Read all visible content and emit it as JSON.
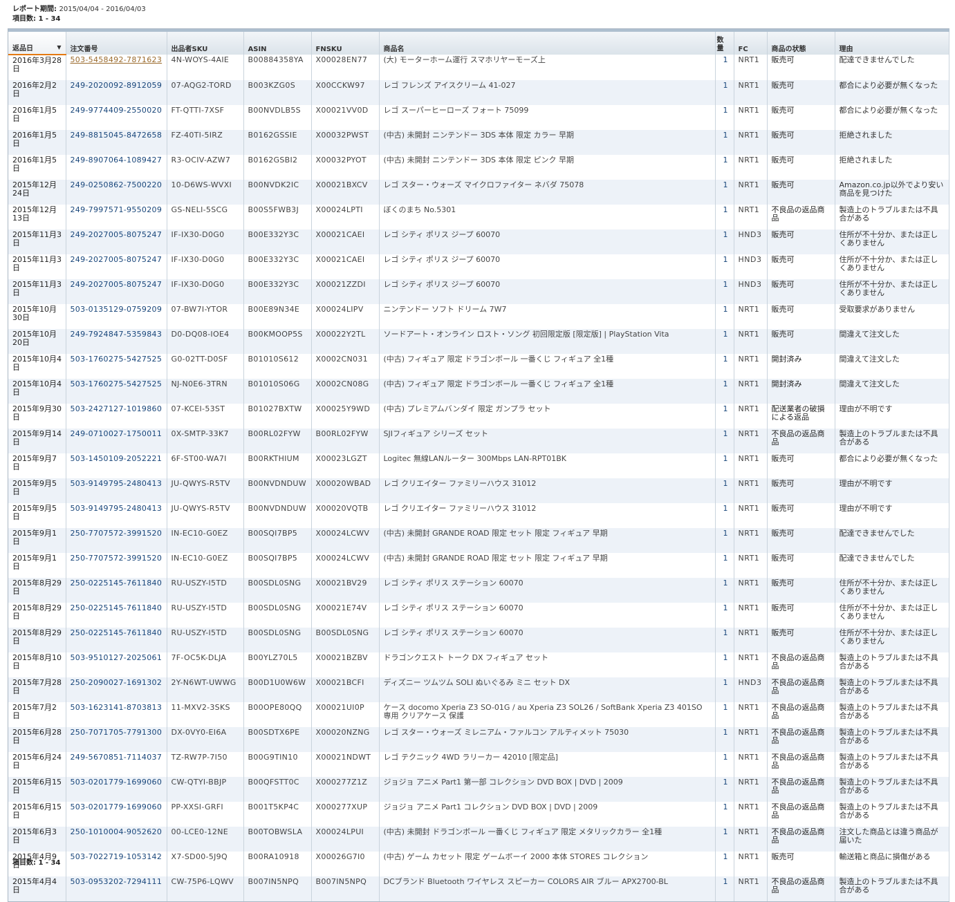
{
  "report": {
    "period_label": "レポート期間: ",
    "period_value": "2015/04/04 - 2016/04/03",
    "count_label": "項目数: ",
    "count_value": "1 - 34"
  },
  "columns": {
    "return_date": "返品日",
    "order_id": "注文番号",
    "seller_sku": "出品者SKU",
    "asin": "ASIN",
    "fnsku": "FNSKU",
    "product_name": "商品名",
    "quantity": "数量",
    "fc": "FC",
    "condition": "商品の状態",
    "reason": "理由"
  },
  "rows": [
    {
      "date": "2016年3月28日",
      "order": "503-5458492-7871623",
      "sku": "4N-WOYS-4AIE",
      "asin": "B00884358YA",
      "fnsku": "X00028EN77",
      "product": "(大) モーターホーム運行 スマホリヤーモーズ上",
      "qty": "1",
      "fc": "NRT1",
      "condition": "販売可",
      "reason": "配達できませんでした"
    },
    {
      "date": "2016年2月2日",
      "order": "249-2020092-8912059",
      "sku": "07-AQG2-TORD",
      "asin": "B003KZG0S",
      "fnsku": "X00CCKW97",
      "product": "レゴ フレンズ アイスクリーム 41-027",
      "qty": "1",
      "fc": "NRT1",
      "condition": "販売可",
      "reason": "都合により必要が無くなった"
    },
    {
      "date": "2016年1月5日",
      "order": "249-9774409-2550020",
      "sku": "FT-QTTI-7XSF",
      "asin": "B00NVDLB5S",
      "fnsku": "X00021VV0D",
      "product": "レゴ スーパーヒーローズ フォート 75099",
      "qty": "1",
      "fc": "NRT1",
      "condition": "販売可",
      "reason": "都合により必要が無くなった"
    },
    {
      "date": "2016年1月5日",
      "order": "249-8815045-8472658",
      "sku": "FZ-40TI-5IRZ",
      "asin": "B0162GSSIE",
      "fnsku": "X00032PWST",
      "product": "(中古) 未開封 ニンテンドー 3DS 本体 限定 カラー 早期",
      "qty": "1",
      "fc": "NRT1",
      "condition": "販売可",
      "reason": "拒絶されました"
    },
    {
      "date": "2016年1月5日",
      "order": "249-8907064-1089427",
      "sku": "R3-OCIV-AZW7",
      "asin": "B0162GSBI2",
      "fnsku": "X00032PYOT",
      "product": "(中古) 未開封 ニンテンドー 3DS 本体 限定 ピンク 早期",
      "qty": "1",
      "fc": "NRT1",
      "condition": "販売可",
      "reason": "拒絶されました"
    },
    {
      "date": "2015年12月24日",
      "order": "249-0250862-7500220",
      "sku": "10-D6WS-WVXI",
      "asin": "B00NVDK2IC",
      "fnsku": "X00021BXCV",
      "product": "レゴ スター・ウォーズ マイクロファイター ネバダ 75078",
      "qty": "1",
      "fc": "NRT1",
      "condition": "販売可",
      "reason": "Amazon.co.jp以外でより安い商品を見つけた"
    },
    {
      "date": "2015年12月13日",
      "order": "249-7997571-9550209",
      "sku": "GS-NELI-5SCG",
      "asin": "B00S5FWB3J",
      "fnsku": "X00024LPTI",
      "product": "ぼくのまち No.5301",
      "qty": "1",
      "fc": "NRT1",
      "condition": "不良品の返品商品",
      "reason": "製造上のトラブルまたは不具合がある"
    },
    {
      "date": "2015年11月3日",
      "order": "249-2027005-8075247",
      "sku": "IF-IX30-D0G0",
      "asin": "B00E332Y3C",
      "fnsku": "X00021CAEI",
      "product": "レゴ シティ ポリス ジープ 60070",
      "qty": "1",
      "fc": "HND3",
      "condition": "販売可",
      "reason": "住所が不十分か、または正しくありません"
    },
    {
      "date": "2015年11月3日",
      "order": "249-2027005-8075247",
      "sku": "IF-IX30-D0G0",
      "asin": "B00E332Y3C",
      "fnsku": "X00021CAEI",
      "product": "レゴ シティ ポリス ジープ 60070",
      "qty": "1",
      "fc": "HND3",
      "condition": "販売可",
      "reason": "住所が不十分か、または正しくありません"
    },
    {
      "date": "2015年11月3日",
      "order": "249-2027005-8075247",
      "sku": "IF-IX30-D0G0",
      "asin": "B00E332Y3C",
      "fnsku": "X00021ZZDI",
      "product": "レゴ シティ ポリス ジープ 60070",
      "qty": "1",
      "fc": "HND3",
      "condition": "販売可",
      "reason": "住所が不十分か、または正しくありません"
    },
    {
      "date": "2015年10月30日",
      "order": "503-0135129-0759209",
      "sku": "07-BW7I-YTOR",
      "asin": "B00E89N34E",
      "fnsku": "X00024LIPV",
      "product": "ニンテンドー ソフト ドリーム 7W7",
      "qty": "1",
      "fc": "NRT1",
      "condition": "販売可",
      "reason": "受取要求がありません"
    },
    {
      "date": "2015年10月20日",
      "order": "249-7924847-5359843",
      "sku": "D0-DQ08-IOE4",
      "asin": "B00KMOOP5S",
      "fnsku": "X00022Y2TL",
      "product": "ソードアート・オンライン ロスト・ソング 初回限定版 [限定版] | PlayStation Vita",
      "qty": "1",
      "fc": "NRT1",
      "condition": "販売可",
      "reason": "間違えて注文した"
    },
    {
      "date": "2015年10月4日",
      "order": "503-1760275-5427525",
      "sku": "G0-02TT-D0SF",
      "asin": "B01010S612",
      "fnsku": "X0002CN031",
      "product": "(中古) フィギュア 限定 ドラゴンボール 一番くじ フィギュア 全1種",
      "qty": "1",
      "fc": "NRT1",
      "condition": "開封済み",
      "reason": "間違えて注文した"
    },
    {
      "date": "2015年10月4日",
      "order": "503-1760275-5427525",
      "sku": "NJ-N0E6-3TRN",
      "asin": "B01010S06G",
      "fnsku": "X0002CN08G",
      "product": "(中古) フィギュア 限定 ドラゴンボール 一番くじ フィギュア 全1種",
      "qty": "1",
      "fc": "NRT1",
      "condition": "開封済み",
      "reason": "間違えて注文した"
    },
    {
      "date": "2015年9月30日",
      "order": "503-2427127-1019860",
      "sku": "07-KCEI-53ST",
      "asin": "B01027BXTW",
      "fnsku": "X00025Y9WD",
      "product": "(中古) プレミアムバンダイ 限定 ガンプラ セット",
      "qty": "1",
      "fc": "NRT1",
      "condition": "配送業者の破損による返品",
      "reason": "理由が不明です"
    },
    {
      "date": "2015年9月14日",
      "order": "249-0710027-1750011",
      "sku": "0X-SMTP-33K7",
      "asin": "B00RL02FYW",
      "fnsku": "B00RL02FYW",
      "product": "SJIフィギュア シリーズ セット",
      "qty": "1",
      "fc": "NRT1",
      "condition": "不良品の返品商品",
      "reason": "製造上のトラブルまたは不具合がある"
    },
    {
      "date": "2015年9月7日",
      "order": "503-1450109-2052221",
      "sku": "6F-ST00-WA7I",
      "asin": "B00RKTHIUM",
      "fnsku": "X00023LGZT",
      "product": "Logitec 無線LANルーター 300Mbps LAN-RPT01BK",
      "qty": "1",
      "fc": "NRT1",
      "condition": "販売可",
      "reason": "都合により必要が無くなった"
    },
    {
      "date": "2015年9月5日",
      "order": "503-9149795-2480413",
      "sku": "JU-QWYS-R5TV",
      "asin": "B00NVDNDUW",
      "fnsku": "X00020WBAD",
      "product": "レゴ クリエイター ファミリーハウス 31012",
      "qty": "1",
      "fc": "NRT1",
      "condition": "販売可",
      "reason": "理由が不明です"
    },
    {
      "date": "2015年9月5日",
      "order": "503-9149795-2480413",
      "sku": "JU-QWYS-R5TV",
      "asin": "B00NVDNDUW",
      "fnsku": "X00020VQTB",
      "product": "レゴ クリエイター ファミリーハウス 31012",
      "qty": "1",
      "fc": "NRT1",
      "condition": "販売可",
      "reason": "理由が不明です"
    },
    {
      "date": "2015年9月1日",
      "order": "250-7707572-3991520",
      "sku": "IN-EC10-G0EZ",
      "asin": "B00SQI7BP5",
      "fnsku": "X00024LCWV",
      "product": "(中古) 未開封 GRANDE ROAD 限定 セット 限定 フィギュア 早期",
      "qty": "1",
      "fc": "NRT1",
      "condition": "販売可",
      "reason": "配達できませんでした"
    },
    {
      "date": "2015年9月1日",
      "order": "250-7707572-3991520",
      "sku": "IN-EC10-G0EZ",
      "asin": "B00SQI7BP5",
      "fnsku": "X00024LCWV",
      "product": "(中古) 未開封 GRANDE ROAD 限定 セット 限定 フィギュア 早期",
      "qty": "1",
      "fc": "NRT1",
      "condition": "販売可",
      "reason": "配達できませんでした"
    },
    {
      "date": "2015年8月29日",
      "order": "250-0225145-7611840",
      "sku": "RU-USZY-I5TD",
      "asin": "B00SDL0SNG",
      "fnsku": "X00021BV29",
      "product": "レゴ シティ ポリス ステーション 60070",
      "qty": "1",
      "fc": "NRT1",
      "condition": "販売可",
      "reason": "住所が不十分か、または正しくありません"
    },
    {
      "date": "2015年8月29日",
      "order": "250-0225145-7611840",
      "sku": "RU-USZY-I5TD",
      "asin": "B00SDL0SNG",
      "fnsku": "X00021E74V",
      "product": "レゴ シティ ポリス ステーション 60070",
      "qty": "1",
      "fc": "NRT1",
      "condition": "販売可",
      "reason": "住所が不十分か、または正しくありません"
    },
    {
      "date": "2015年8月29日",
      "order": "250-0225145-7611840",
      "sku": "RU-USZY-I5TD",
      "asin": "B00SDL0SNG",
      "fnsku": "B00SDL0SNG",
      "product": "レゴ シティ ポリス ステーション 60070",
      "qty": "1",
      "fc": "NRT1",
      "condition": "販売可",
      "reason": "住所が不十分か、または正しくありません"
    },
    {
      "date": "2015年8月10日",
      "order": "503-9510127-2025061",
      "sku": "7F-OC5K-DLJA",
      "asin": "B00YLZ70L5",
      "fnsku": "X00021BZBV",
      "product": "ドラゴンクエスト トーク DX フィギュア セット",
      "qty": "1",
      "fc": "NRT1",
      "condition": "不良品の返品商品",
      "reason": "製造上のトラブルまたは不具合がある"
    },
    {
      "date": "2015年7月28日",
      "order": "250-2090027-1691302",
      "sku": "2Y-N6WT-UWWG",
      "asin": "B00D1U0W6W",
      "fnsku": "X00021BCFI",
      "product": "ディズニー ツムツム SOLI ぬいぐるみ ミニ セット DX",
      "qty": "1",
      "fc": "HND3",
      "condition": "不良品の返品商品",
      "reason": "製造上のトラブルまたは不具合がある"
    },
    {
      "date": "2015年7月2日",
      "order": "503-1623141-8703813",
      "sku": "11-MXV2-3SKS",
      "asin": "B00OPE80QQ",
      "fnsku": "X00021UI0P",
      "product": "ケース docomo Xperia Z3 SO-01G / au Xperia Z3 SOL26 / SoftBank Xperia Z3 401SO 専用 クリアケース 保護",
      "qty": "1",
      "fc": "NRT1",
      "condition": "不良品の返品商品",
      "reason": "製造上のトラブルまたは不具合がある"
    },
    {
      "date": "2015年6月28日",
      "order": "250-7071705-7791300",
      "sku": "DX-0VY0-EI6A",
      "asin": "B00SDTX6PE",
      "fnsku": "X00020NZNG",
      "product": "レゴ スター・ウォーズ ミレニアム・ファルコン アルティメット 75030",
      "qty": "1",
      "fc": "NRT1",
      "condition": "不良品の返品商品",
      "reason": "製造上のトラブルまたは不具合がある"
    },
    {
      "date": "2015年6月24日",
      "order": "249-5670851-7114037",
      "sku": "TZ-RW7P-7I50",
      "asin": "B00G9TIN10",
      "fnsku": "X00021NDWT",
      "product": "レゴ テクニック 4WD ラリーカー 42010 [限定品]",
      "qty": "1",
      "fc": "NRT1",
      "condition": "不良品の返品商品",
      "reason": "製造上のトラブルまたは不具合がある"
    },
    {
      "date": "2015年6月15日",
      "order": "503-0201779-1699060",
      "sku": "CW-QTYI-BBJP",
      "asin": "B00QFSTT0C",
      "fnsku": "X000277Z1Z",
      "product": "ジョジョ アニメ Part1 第一部 コレクション DVD BOX | DVD | 2009",
      "qty": "1",
      "fc": "NRT1",
      "condition": "不良品の返品商品",
      "reason": "製造上のトラブルまたは不具合がある"
    },
    {
      "date": "2015年6月15日",
      "order": "503-0201779-1699060",
      "sku": "PP-XXSI-GRFI",
      "asin": "B001T5KP4C",
      "fnsku": "X000277XUP",
      "product": "ジョジョ アニメ Part1 コレクション DVD BOX | DVD | 2009",
      "qty": "1",
      "fc": "NRT1",
      "condition": "不良品の返品商品",
      "reason": "製造上のトラブルまたは不具合がある"
    },
    {
      "date": "2015年6月3日",
      "order": "250-1010004-9052620",
      "sku": "00-LCE0-12NE",
      "asin": "B00TOBWSLA",
      "fnsku": "X00024LPUI",
      "product": "(中古) 未開封 ドラゴンボール 一番くじ フィギュア 限定 メタリックカラー 全1種",
      "qty": "1",
      "fc": "NRT1",
      "condition": "不良品の返品商品",
      "reason": "注文した商品とは違う商品が届いた"
    },
    {
      "date": "2015年4月9日",
      "order": "503-7022719-1053142",
      "sku": "X7-SD00-5J9Q",
      "asin": "B00RA10918",
      "fnsku": "X00026G7I0",
      "product": "(中古) ゲーム カセット 限定 ゲームボーイ 2000 本体 STORES コレクション",
      "qty": "1",
      "fc": "NRT1",
      "condition": "販売可",
      "reason": "輸送箱と商品に損傷がある"
    },
    {
      "date": "2015年4月4日",
      "order": "503-0953202-7294111",
      "sku": "CW-75P6-LQWV",
      "asin": "B007IN5NPQ",
      "fnsku": "B007IN5NPQ",
      "product": "DCブランド Bluetooth ワイヤレス スピーカー COLORS AIR ブルー APX2700-BL",
      "qty": "1",
      "fc": "NRT1",
      "condition": "不良品の返品商品",
      "reason": "製造上のトラブルまたは不具合がある"
    }
  ]
}
